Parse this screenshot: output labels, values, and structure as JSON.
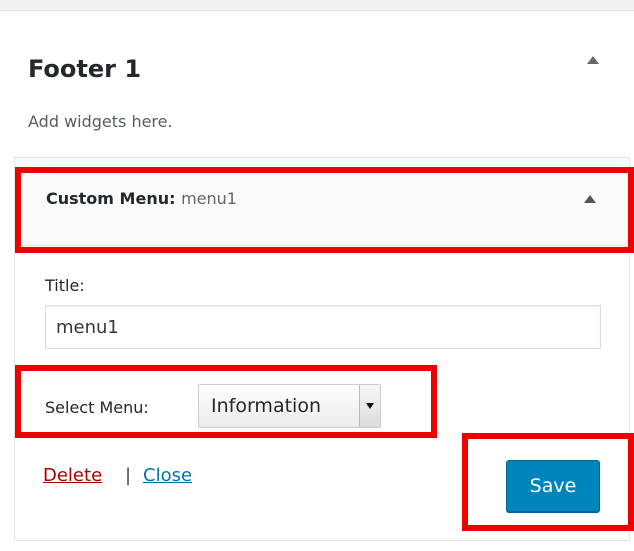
{
  "sidebar": {
    "title": "Footer 1",
    "description": "Add widgets here."
  },
  "widget": {
    "title_prefix": "Custom Menu:",
    "instance_title": "menu1",
    "fields": {
      "title_label": "Title:",
      "title_value": "menu1",
      "select_menu_label": "Select Menu:",
      "select_menu_value": "Information"
    },
    "actions": {
      "delete_label": "Delete",
      "separator": "|",
      "close_label": "Close",
      "save_label": "Save"
    }
  },
  "icons": {
    "sidebar_toggle": "arrow-up-icon",
    "widget_toggle": "arrow-up-icon",
    "select_arrow": "chevron-down-icon"
  },
  "colors": {
    "highlight": "#ee0000",
    "save_button": "#0085ba",
    "delete_link": "#aa0000",
    "close_link": "#0073aa"
  }
}
